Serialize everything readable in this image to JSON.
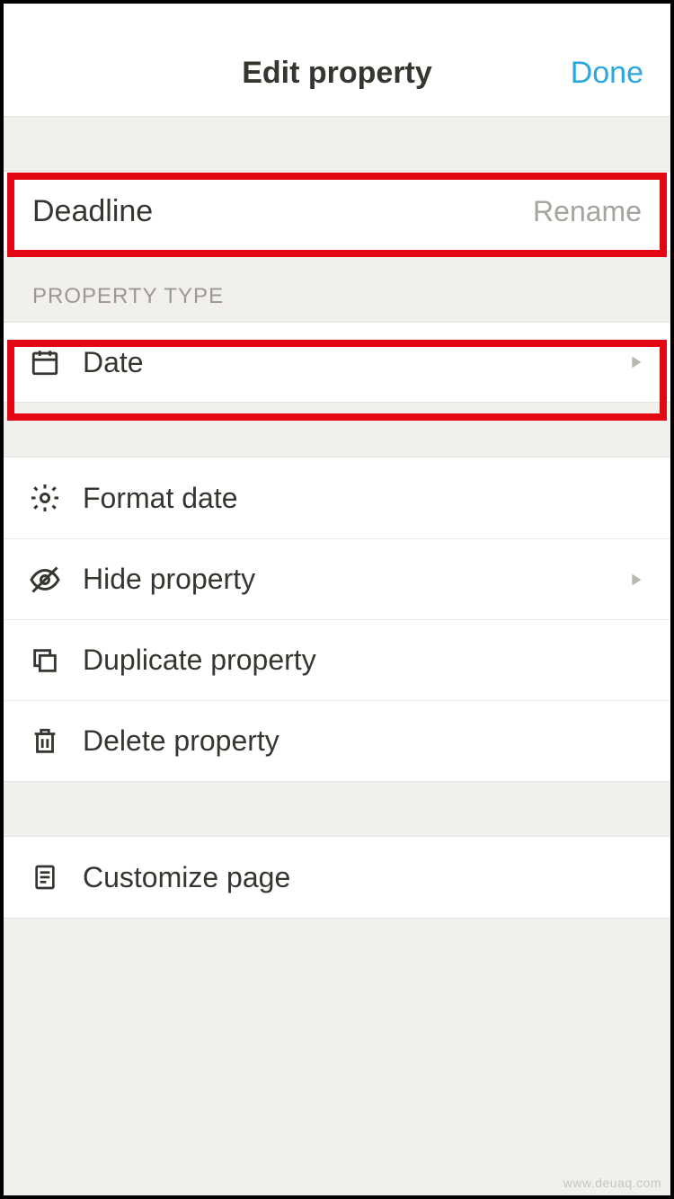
{
  "header": {
    "title": "Edit property",
    "done": "Done"
  },
  "rename": {
    "value": "Deadline",
    "hint": "Rename"
  },
  "sections": {
    "property_type_label": "PROPERTY TYPE",
    "property_type_value": "Date"
  },
  "actions": {
    "format_date": "Format date",
    "hide_property": "Hide property",
    "duplicate_property": "Duplicate property",
    "delete_property": "Delete property",
    "customize_page": "Customize page"
  },
  "watermark": "www.deuaq.com"
}
